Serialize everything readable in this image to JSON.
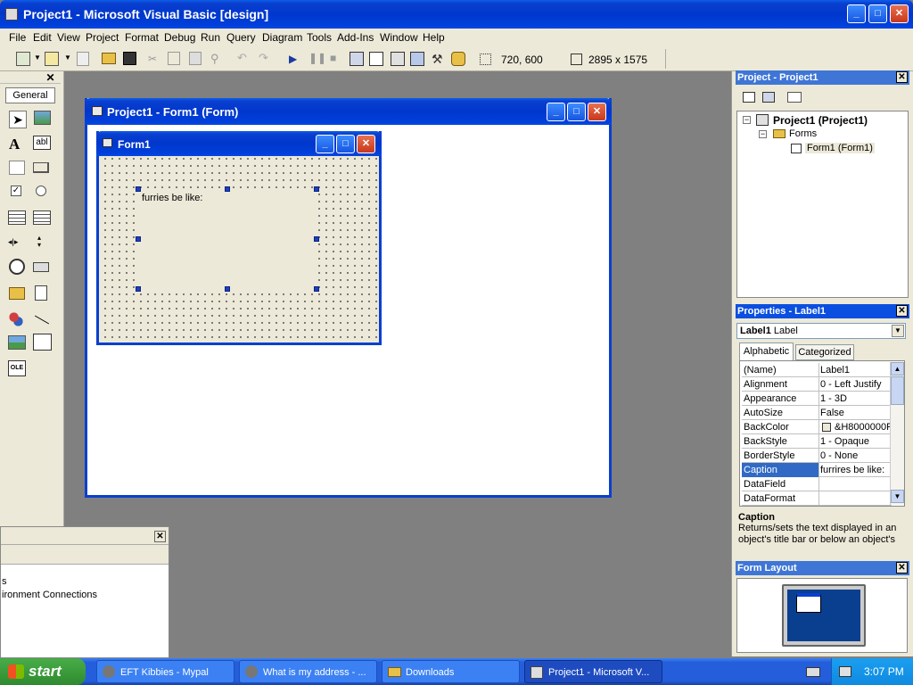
{
  "window": {
    "title": "Project1 - Microsoft Visual Basic [design]"
  },
  "menu": [
    "File",
    "Edit",
    "View",
    "Project",
    "Format",
    "Debug",
    "Run",
    "Query",
    "Diagram",
    "Tools",
    "Add-Ins",
    "Window",
    "Help"
  ],
  "toolbar": {
    "position": "720, 600",
    "size": "2895 x 1575"
  },
  "toolbox": {
    "tab": "General"
  },
  "form_window": {
    "title": "Project1 - Form1 (Form)"
  },
  "form": {
    "title": "Form1",
    "label_caption": "furries be like:"
  },
  "project_pane": {
    "title": "Project - Project1",
    "tree": [
      {
        "label": "Project1 (Project1)"
      },
      {
        "label": "Forms"
      },
      {
        "label": "Form1 (Form1)"
      }
    ]
  },
  "properties": {
    "title": "Properties - Label1",
    "object_name": "Label1",
    "object_type": "Label",
    "tabs": [
      "Alphabetic",
      "Categorized"
    ],
    "rows": [
      {
        "name": "(Name)",
        "value": "Label1"
      },
      {
        "name": "Alignment",
        "value": "0 - Left Justify"
      },
      {
        "name": "Appearance",
        "value": "1 - 3D"
      },
      {
        "name": "AutoSize",
        "value": "False"
      },
      {
        "name": "BackColor",
        "value": "&H8000000F"
      },
      {
        "name": "BackStyle",
        "value": "1 - Opaque"
      },
      {
        "name": "BorderStyle",
        "value": "0 - None"
      },
      {
        "name": "Caption",
        "value": "furrires be like:"
      },
      {
        "name": "DataField",
        "value": ""
      },
      {
        "name": "DataFormat",
        "value": ""
      }
    ],
    "desc_title": "Caption",
    "desc_text": "Returns/sets the text displayed in an object's title bar or below an object's"
  },
  "form_layout": {
    "title": "Form Layout"
  },
  "bottom_panel": {
    "line1": "s",
    "line2": "ironment Connections"
  },
  "taskbar": {
    "start": "start",
    "tasks": [
      "EFT Kibbies - Mypal",
      "What is my address - ...",
      "Downloads",
      "Project1 - Microsoft V..."
    ],
    "clock": "3:07 PM"
  },
  "colors": {
    "title_blue": "#0037cc",
    "desktop_gray": "#808080",
    "form_bg": "#ece9d8",
    "taskbar_blue": "#245edb",
    "start_green": "#3c9d3c"
  }
}
